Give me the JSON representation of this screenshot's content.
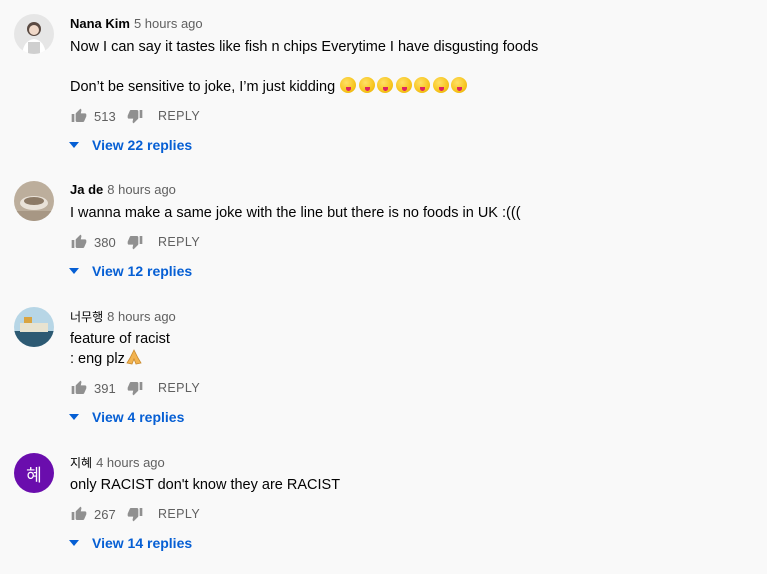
{
  "comments": [
    {
      "author": "Nana Kim",
      "time": "5 hours ago",
      "lines": [
        "Now I can say it tastes like fish n chips Everytime I have disgusting foods",
        "",
        "Don’t be sensitive to joke, I’m just kidding"
      ],
      "likes": "513",
      "reply_label": "REPLY",
      "view_replies": "View 22 replies",
      "avatar_colors": [
        "#d9d9d9",
        "#8a8a8a"
      ]
    },
    {
      "author": "Ja de",
      "time": "8 hours ago",
      "lines": [
        "I wanna make a same joke with the line but there is no foods in UK :((("
      ],
      "likes": "380",
      "reply_label": "REPLY",
      "view_replies": "View 12 replies",
      "avatar_colors": [
        "#c8b8a6",
        "#9a8673"
      ]
    },
    {
      "author": "너무행",
      "time": "8 hours ago",
      "lines": [
        "feature of racist",
        ": eng plz"
      ],
      "likes": "391",
      "reply_label": "REPLY",
      "view_replies": "View 4 replies",
      "avatar_colors": [
        "#9ec5d8",
        "#3a6e8c"
      ]
    },
    {
      "author": "지혜",
      "time": "4 hours ago",
      "lines": [
        "only RACIST don't know they are RACIST"
      ],
      "likes": "267",
      "reply_label": "REPLY",
      "view_replies": "View 14 replies",
      "avatar_letter": "혜",
      "avatar_colors": [
        "#6a0dad"
      ]
    }
  ],
  "icons": {
    "like": "thumbs-up-icon",
    "dislike": "thumbs-down-icon",
    "expand": "chevron-down-icon",
    "emoji": "tongue-face-emoji",
    "pray": "praying-hands-emoji"
  },
  "colors": {
    "background": "#f9f9f9",
    "link": "#065fd4",
    "muted": "#606060",
    "text": "#030303"
  }
}
